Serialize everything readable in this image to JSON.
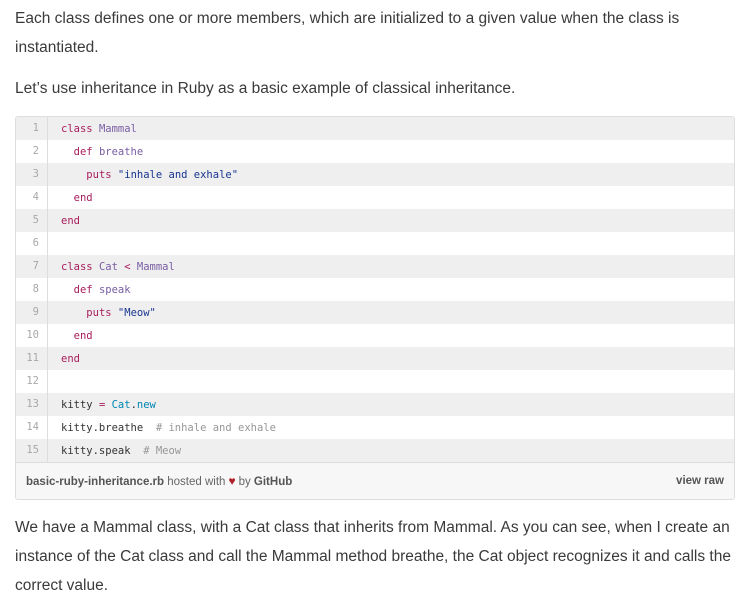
{
  "paragraphs": {
    "intro": "Each class defines one or more members, which are initialized to a given value when the class is instantiated.",
    "lead": "Let’s use inheritance in Ruby as a basic example of classical inheritance.",
    "outro": "We have a Mammal class, with a Cat class that inherits from Mammal. As you can see, when I create an instance of the Cat class and call the Mammal method breathe, the Cat object recognizes it and calls the correct value."
  },
  "gist": {
    "lines": [
      {
        "n": "1",
        "code": "class Mammal"
      },
      {
        "n": "2",
        "code": "  def breathe"
      },
      {
        "n": "3",
        "code": "    puts \"inhale and exhale\""
      },
      {
        "n": "4",
        "code": "  end"
      },
      {
        "n": "5",
        "code": "end"
      },
      {
        "n": "6",
        "code": ""
      },
      {
        "n": "7",
        "code": "class Cat < Mammal"
      },
      {
        "n": "8",
        "code": "  def speak"
      },
      {
        "n": "9",
        "code": "    puts \"Meow\""
      },
      {
        "n": "10",
        "code": "  end"
      },
      {
        "n": "11",
        "code": "end"
      },
      {
        "n": "12",
        "code": ""
      },
      {
        "n": "13",
        "code": "kitty = Cat.new"
      },
      {
        "n": "14",
        "code": "kitty.breathe  # inhale and exhale"
      },
      {
        "n": "15",
        "code": "kitty.speak  # Meow"
      }
    ],
    "filename": "basic-ruby-inheritance.rb",
    "hosted_text": "hosted with",
    "by_text": "by",
    "host": "GitHub",
    "view_raw": "view raw",
    "heart_icon": "heart-icon"
  }
}
